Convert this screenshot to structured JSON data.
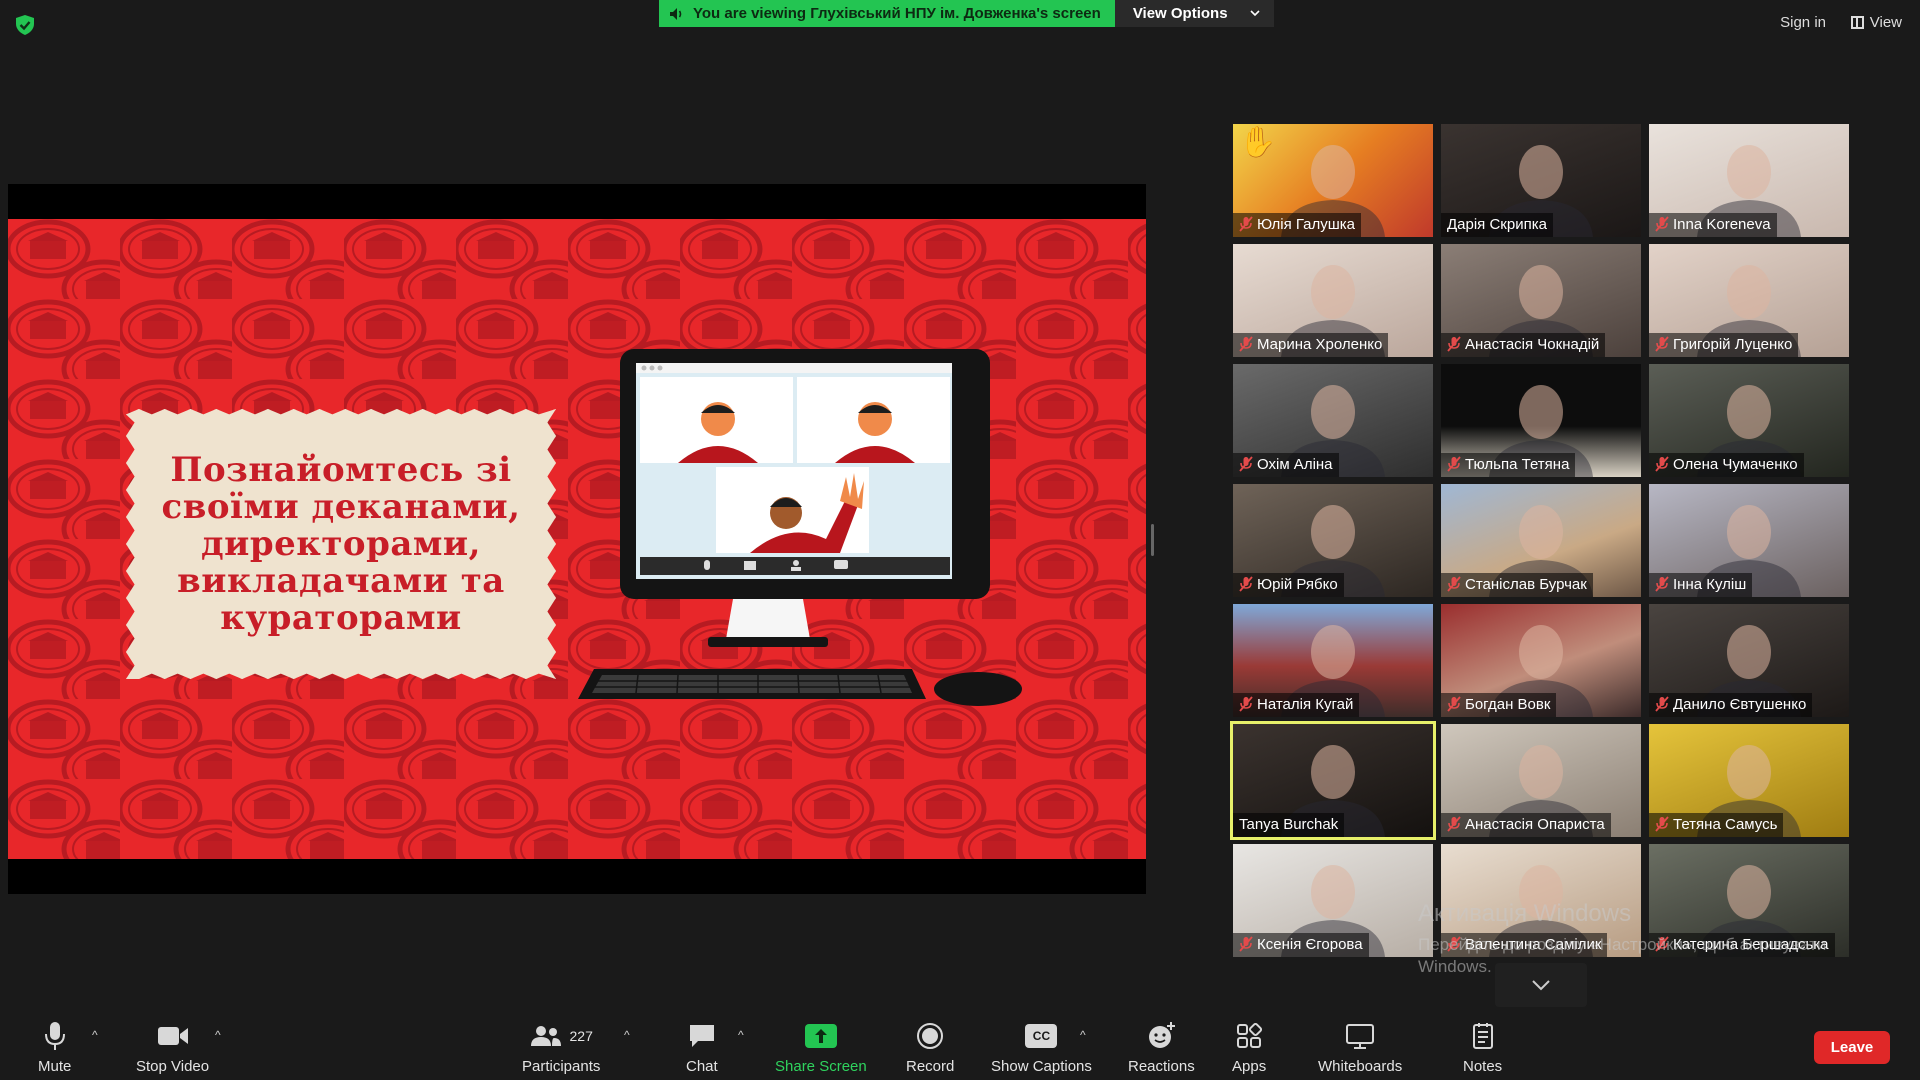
{
  "banner": {
    "text": "You are viewing Глухівський НПУ ім. Довженка's screen",
    "view_options": "View Options"
  },
  "header": {
    "sign_in": "Sign in",
    "view": "View"
  },
  "slide": {
    "title": "Познайомтесь зі своїми деканами, директорами, викладачами та кураторами"
  },
  "participants": [
    {
      "name": "Юлія Галушка",
      "muted": true,
      "hand_raised": true
    },
    {
      "name": "Дарія Скрипка",
      "muted": false
    },
    {
      "name": "Inna Koreneva",
      "muted": true
    },
    {
      "name": "Марина Хроленко",
      "muted": true
    },
    {
      "name": "Анастасія Чокнадій",
      "muted": true
    },
    {
      "name": "Григорій Луценко",
      "muted": true
    },
    {
      "name": "Охім Аліна",
      "muted": true
    },
    {
      "name": "Тюльпа Тетяна",
      "muted": true
    },
    {
      "name": "Олена Чумаченко",
      "muted": true
    },
    {
      "name": "Юрій Рябко",
      "muted": true
    },
    {
      "name": "Станіслав Бурчак",
      "muted": true
    },
    {
      "name": "Інна Куліш",
      "muted": true
    },
    {
      "name": "Наталія Кугай",
      "muted": true
    },
    {
      "name": "Богдан Вовк",
      "muted": true
    },
    {
      "name": "Данило Євтушенко",
      "muted": true
    },
    {
      "name": "Tanya Burchak",
      "muted": false,
      "active_speaker": true
    },
    {
      "name": "Анастасія Опариста",
      "muted": true
    },
    {
      "name": "Тетяна Самусь",
      "muted": true
    },
    {
      "name": "Ксенія Єгорова",
      "muted": true
    },
    {
      "name": "Валентина Самілик",
      "muted": true
    },
    {
      "name": "Катерина Бершадська",
      "muted": true
    }
  ],
  "watermark": {
    "title": "Активація Windows",
    "subtitle": "Перейдіть до розділу «Настройки», щоб активувати Windows."
  },
  "toolbar": {
    "mute": "Mute",
    "stop_video": "Stop Video",
    "participants": "Participants",
    "participants_count": "227",
    "chat": "Chat",
    "share_screen": "Share Screen",
    "record": "Record",
    "show_captions": "Show Captions",
    "captions_icon_text": "CC",
    "reactions": "Reactions",
    "apps": "Apps",
    "whiteboards": "Whiteboards",
    "notes": "Notes",
    "leave": "Leave"
  },
  "colors": {
    "share_green": "#23c552",
    "leave_red": "#e02828",
    "active_speaker": "#e7f06a",
    "slide_red": "#e8272a"
  }
}
